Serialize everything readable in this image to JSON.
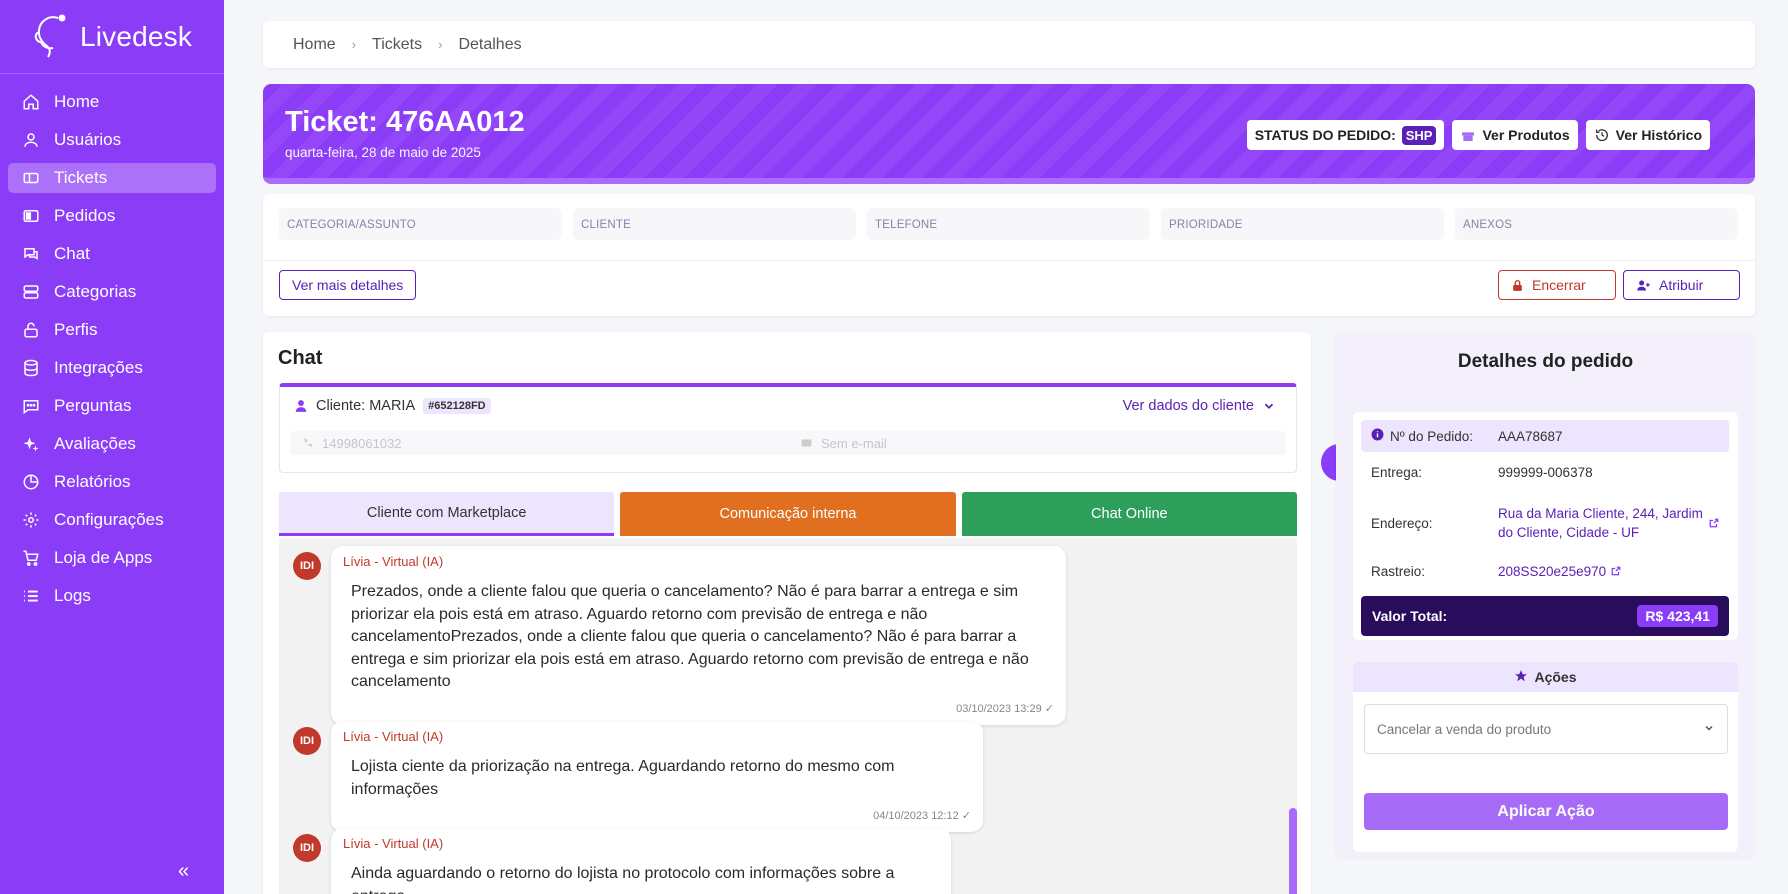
{
  "app": {
    "name": "Livedesk"
  },
  "sidebar": {
    "items": [
      {
        "label": "Home",
        "icon": "home-icon"
      },
      {
        "label": "Usuários",
        "icon": "user-icon"
      },
      {
        "label": "Tickets",
        "icon": "ticket-icon",
        "active": true
      },
      {
        "label": "Pedidos",
        "icon": "orders-icon"
      },
      {
        "label": "Chat",
        "icon": "chat-icon"
      },
      {
        "label": "Categorias",
        "icon": "categories-icon"
      },
      {
        "label": "Perfis",
        "icon": "lock-icon"
      },
      {
        "label": "Integrações",
        "icon": "database-icon"
      },
      {
        "label": "Perguntas",
        "icon": "questions-icon"
      },
      {
        "label": "Avaliações",
        "icon": "sparkle-icon"
      },
      {
        "label": "Relatórios",
        "icon": "pie-chart-icon"
      },
      {
        "label": "Configurações",
        "icon": "gear-icon"
      },
      {
        "label": "Loja de Apps",
        "icon": "cart-icon"
      },
      {
        "label": "Logs",
        "icon": "list-icon"
      }
    ],
    "collapse_label": "«"
  },
  "breadcrumb": {
    "items": [
      "Home",
      "Tickets",
      "Detalhes"
    ],
    "separator": "›"
  },
  "ticket": {
    "title": "Ticket: 476AA012",
    "date": "quarta-feira, 28 de maio de 2025",
    "status_label": "STATUS DO PEDIDO:",
    "status_value": "SHP",
    "ver_produtos": "Ver Produtos",
    "ver_historico": "Ver Histórico"
  },
  "fields": {
    "labels": [
      "CATEGORIA/ASSUNTO",
      "CLIENTE",
      "TELEFONE",
      "PRIORIDADE",
      "ANEXOS"
    ],
    "ver_mais": "Ver mais detalhes",
    "encerrar": "Encerrar",
    "atribuir": "Atribuir"
  },
  "chat": {
    "title": "Chat",
    "client_label": "Cliente: MARIA",
    "client_code": "#652128FD",
    "ver_dados": "Ver dados do cliente",
    "phone": "14998061032",
    "email": "Sem e-mail",
    "tabs": [
      "Cliente com Marketplace",
      "Comunicação interna",
      "Chat Online"
    ],
    "messages": [
      {
        "initials": "IDI",
        "sender": "Lívia - Virtual (IA)",
        "text": "Prezados, onde a cliente falou que queria o cancelamento? Não é para barrar a entrega e sim priorizar ela pois está em atraso. Aguardo retorno com previsão de entrega e não cancelamentoPrezados, onde a cliente falou que queria o cancelamento? Não é para barrar a entrega e sim priorizar ela pois está em atraso. Aguardo retorno com previsão de entrega e não cancelamento",
        "time": "03/10/2023 13:29"
      },
      {
        "initials": "IDI",
        "sender": "Lívia - Virtual (IA)",
        "text": "Lojista ciente da priorização na entrega. Aguardando retorno do mesmo com informações",
        "time": "04/10/2023 12:12"
      },
      {
        "initials": "IDI",
        "sender": "Lívia - Virtual (IA)",
        "text": "Ainda aguardando o retorno do lojista no protocolo com informações sobre a entrega",
        "time": ""
      }
    ]
  },
  "order": {
    "title": "Detalhes do pedido",
    "rows": [
      {
        "key": "Nº do Pedido:",
        "value": "AAA78687"
      },
      {
        "key": "Entrega:",
        "value": "999999-006378"
      },
      {
        "key": "Endereço:",
        "value": "Rua da Maria Cliente, 244, Jardim do Cliente, Cidade - UF"
      },
      {
        "key": "Rastreio:",
        "value": "208SS20e25e970"
      }
    ],
    "total_label": "Valor Total:",
    "total_value": "R$ 423,41",
    "actions_title": "Ações",
    "select_value": "Cancelar a venda do produto",
    "apply": "Aplicar Ação"
  },
  "colors": {
    "primary": "#8b3cf7",
    "dark": "#2a0c5c",
    "orange": "#e0701f",
    "green": "#2e9e5b",
    "red": "#c0392b"
  }
}
